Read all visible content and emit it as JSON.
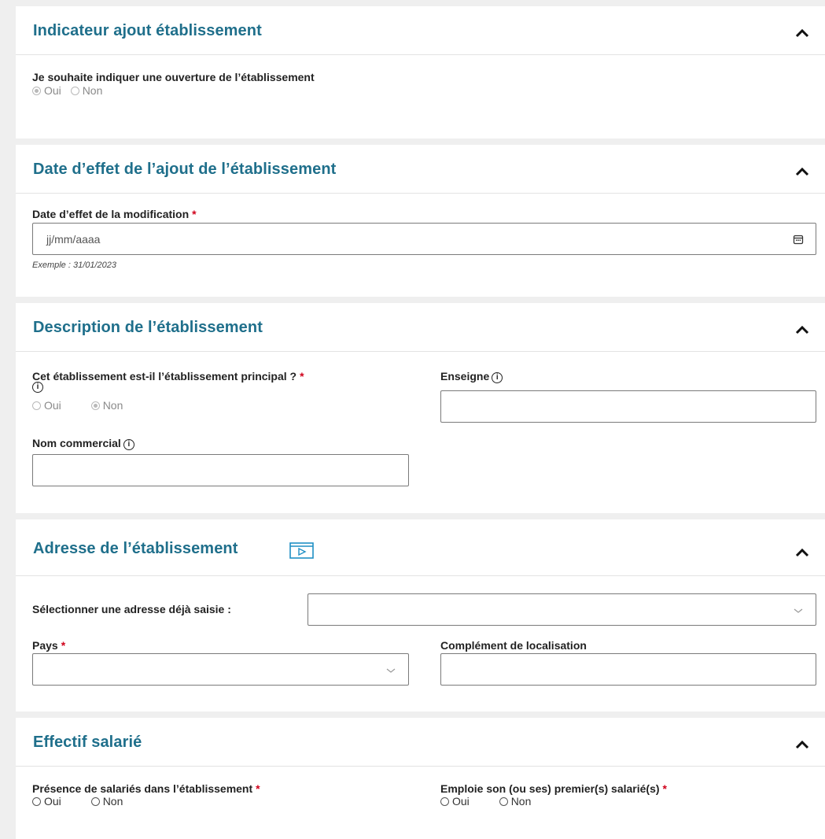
{
  "sections": {
    "indicateur": {
      "title": "Indicateur ajout établissement",
      "question": "Je souhaite indiquer une ouverture de l’établissement",
      "options": [
        "Oui",
        "Non"
      ],
      "selected": "Oui"
    },
    "date_effet": {
      "title": "Date d’effet de l’ajout de l’établissement",
      "label": "Date d’effet de la modification",
      "required_mark": "*",
      "placeholder": "jj/mm/aaaa",
      "hint": "Exemple : 31/01/2023",
      "icon": "calendar-icon"
    },
    "description": {
      "title": "Description de l’établissement",
      "principal_label": "Cet établissement est-il l’établissement principal ?",
      "required_mark": "*",
      "principal_options": [
        "Oui",
        "Non"
      ],
      "principal_selected": "Non",
      "enseigne_label": "Enseigne",
      "nom_commercial_label": "Nom commercial",
      "info_glyph": "i"
    },
    "adresse": {
      "title": "Adresse de l’établissement",
      "title_icon": "video-play-icon",
      "select_label": "Sélectionner une adresse déjà saisie :",
      "pays_label": "Pays",
      "required_mark": "*",
      "complement_label": "Complément de localisation"
    },
    "effectif": {
      "title": "Effectif salarié",
      "presence_label": "Présence de salariés dans l’établissement",
      "emploie_label": "Emploie son (ou ses) premier(s) salarié(s)",
      "required_mark": "*",
      "options": [
        "Oui",
        "Non"
      ]
    }
  },
  "colors": {
    "title": "#1f6f8b",
    "required": "#d0021b",
    "background": "#efefef"
  }
}
